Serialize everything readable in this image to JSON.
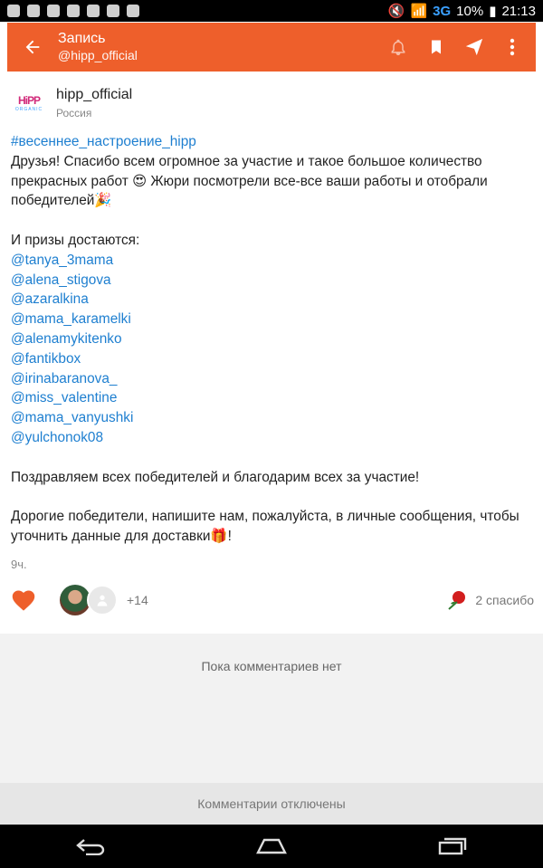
{
  "status_bar": {
    "network": "3G",
    "battery": "10%",
    "time": "21:13"
  },
  "appbar": {
    "title": "Запись",
    "subtitle": "@hipp_official",
    "back_icon": "arrow-left-icon",
    "actions": [
      "bell-icon",
      "bookmark-icon",
      "send-icon",
      "more-vert-icon"
    ]
  },
  "author": {
    "logo_text": "HiPP",
    "logo_sub": "ORGANIC",
    "name": "hipp_official",
    "location": "Россия"
  },
  "post": {
    "hashtag": "#весеннее_настроение_hipp",
    "para1": "Друзья! Спасибо всем огромное за участие и такое большое количество прекрасных работ 😍 Жюри посмотрели все-все ваши работы и отобрали победителей🎉",
    "prizes_intro": "И призы достаются:",
    "winners": [
      "@tanya_3mama",
      "@alena_stigova",
      "@azaralkina",
      "@mama_karamelki",
      "@alenamykitenko",
      "@fantikbox",
      "@irinabaranova_",
      "@miss_valentine",
      "@mama_vanyushki",
      "@yulchonok08"
    ],
    "para2": "Поздравляем всех победителей и благодарим всех за участие!",
    "para3": "Дорогие победители, напишите нам, пожалуйста, в личные сообщения, чтобы уточнить данные для доставки🎁!"
  },
  "meta": {
    "time_ago": "9ч.",
    "likes_more": "+14",
    "thanks": "2 спасибо"
  },
  "comments": {
    "empty_text": "Пока комментариев нет",
    "disabled_text": "Комментарии отключены"
  },
  "colors": {
    "accent": "#ee5f2b",
    "link": "#1e7fd0"
  }
}
